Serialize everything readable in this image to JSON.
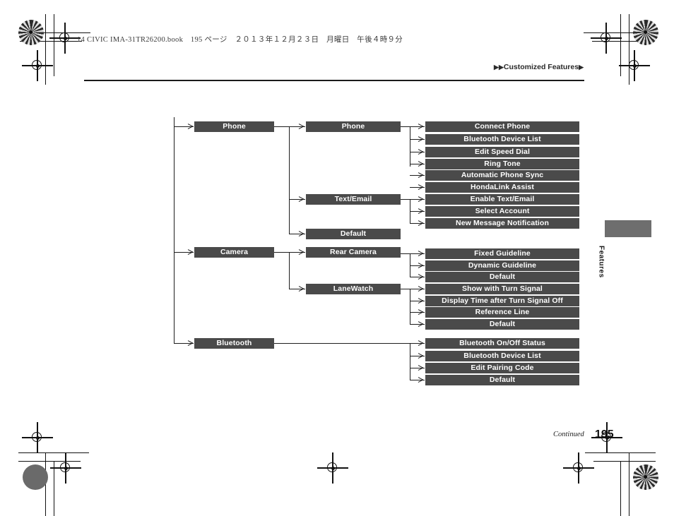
{
  "header": {
    "book_line": "14 CIVIC IMA-31TR26200.book　195 ページ　２０１３年１２月２３日　月曜日　午後４時９分",
    "breadcrumb_prefix": "▶▶",
    "breadcrumb_text": "Customized Features",
    "breadcrumb_suffix": "▶"
  },
  "side_tab": {
    "label": "Features"
  },
  "footer": {
    "continued": "Continued",
    "page_number": "195"
  },
  "flow": {
    "level1": [
      {
        "label": "Phone"
      },
      {
        "label": "Camera"
      },
      {
        "label": "Bluetooth"
      }
    ],
    "level2": [
      {
        "label": "Phone"
      },
      {
        "label": "Text/Email"
      },
      {
        "label": "Default"
      },
      {
        "label": "Rear Camera"
      },
      {
        "label": "LaneWatch"
      }
    ],
    "level3": [
      {
        "label": "Connect Phone"
      },
      {
        "label": "Bluetooth Device List"
      },
      {
        "label": "Edit Speed Dial"
      },
      {
        "label": "Ring Tone"
      },
      {
        "label": "Automatic Phone Sync"
      },
      {
        "label": "HondaLink Assist"
      },
      {
        "label": "Enable Text/Email"
      },
      {
        "label": "Select Account"
      },
      {
        "label": "New Message Notification"
      },
      {
        "label": "Fixed Guideline"
      },
      {
        "label": "Dynamic Guideline"
      },
      {
        "label": "Default"
      },
      {
        "label": "Show with Turn Signal"
      },
      {
        "label": "Display Time after Turn Signal Off"
      },
      {
        "label": "Reference Line"
      },
      {
        "label": "Default"
      },
      {
        "label": "Bluetooth On/Off Status"
      },
      {
        "label": "Bluetooth Device List"
      },
      {
        "label": "Edit Pairing Code"
      },
      {
        "label": "Default"
      }
    ]
  },
  "colors": {
    "node_fill": "#4a4a4a",
    "node_text": "#ffffff",
    "line": "#1d1d1d",
    "tab_fill": "#6e6e6e"
  }
}
